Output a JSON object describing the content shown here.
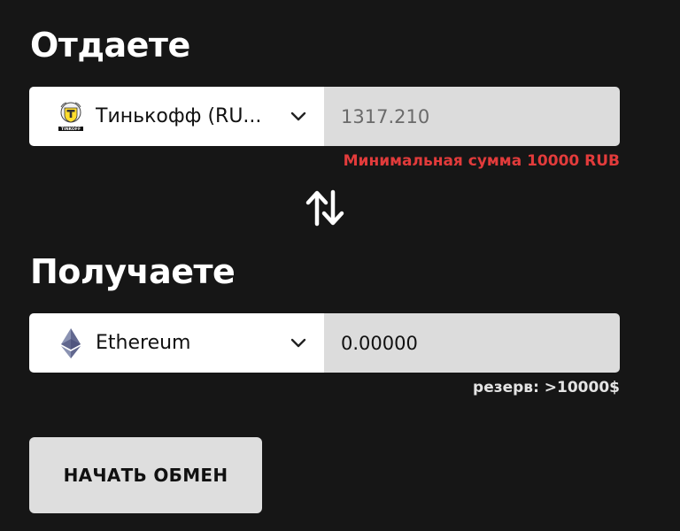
{
  "give": {
    "heading": "Отдаете",
    "currency_label": "Тинькофф (RU...",
    "currency_icon": "tinkoff-logo",
    "amount": "1317.210",
    "error": "Минимальная сумма 10000 RUB"
  },
  "swap_icon": "swap-arrows-icon",
  "get": {
    "heading": "Получаете",
    "currency_label": "Ethereum",
    "currency_icon": "ethereum-logo",
    "amount": "0.00000",
    "reserve": "резерв: >10000$"
  },
  "start_button": "НАЧАТЬ ОБМЕН",
  "colors": {
    "background": "#161616",
    "error": "#e23b3b",
    "input_bg": "#dcdcdc",
    "button_bg": "#dedede"
  }
}
